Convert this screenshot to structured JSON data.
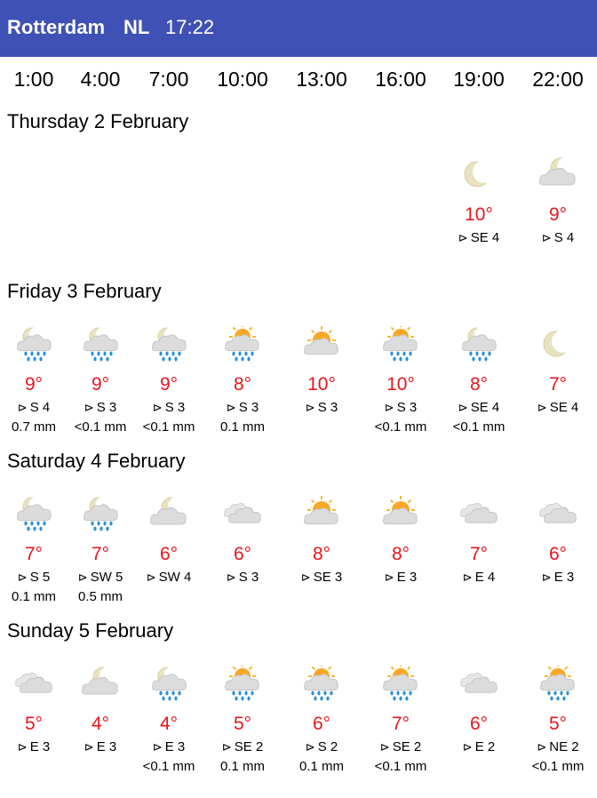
{
  "header": {
    "city": "Rotterdam",
    "country": "NL",
    "time": "17:22"
  },
  "hours": [
    "1:00",
    "4:00",
    "7:00",
    "10:00",
    "13:00",
    "16:00",
    "19:00",
    "22:00"
  ],
  "wind_arrow": "⊳",
  "colors": {
    "header_bg": "#3f51b5",
    "temperature": "#e8141b"
  },
  "days": [
    {
      "title": "Thursday 2 February",
      "slots": [
        null,
        null,
        null,
        null,
        null,
        null,
        {
          "icon": "moon-icon",
          "temp": "10°",
          "wind": "SE 4",
          "rain": ""
        },
        {
          "icon": "moon-cloud-icon",
          "temp": "9°",
          "wind": "S 4",
          "rain": ""
        }
      ]
    },
    {
      "title": "Friday 3 February",
      "slots": [
        {
          "icon": "moon-cloud-rain-icon",
          "temp": "9°",
          "wind": "S 4",
          "rain": "0.7 mm"
        },
        {
          "icon": "moon-cloud-rain-icon",
          "temp": "9°",
          "wind": "S 3",
          "rain": "<0.1 mm"
        },
        {
          "icon": "moon-cloud-rain-icon",
          "temp": "9°",
          "wind": "S 3",
          "rain": "<0.1 mm"
        },
        {
          "icon": "sun-cloud-rain-icon",
          "temp": "8°",
          "wind": "S 3",
          "rain": "0.1 mm"
        },
        {
          "icon": "sun-cloud-icon",
          "temp": "10°",
          "wind": "S 3",
          "rain": ""
        },
        {
          "icon": "sun-cloud-rain-icon",
          "temp": "10°",
          "wind": "S 3",
          "rain": "<0.1 mm"
        },
        {
          "icon": "moon-cloud-rain-icon",
          "temp": "8°",
          "wind": "SE 4",
          "rain": "<0.1 mm"
        },
        {
          "icon": "moon-icon",
          "temp": "7°",
          "wind": "SE 4",
          "rain": ""
        }
      ]
    },
    {
      "title": "Saturday 4 February",
      "slots": [
        {
          "icon": "moon-cloud-rain-icon",
          "temp": "7°",
          "wind": "S 5",
          "rain": "0.1 mm"
        },
        {
          "icon": "moon-cloud-rain-icon",
          "temp": "7°",
          "wind": "SW 5",
          "rain": "0.5 mm"
        },
        {
          "icon": "moon-cloud-icon",
          "temp": "6°",
          "wind": "SW 4",
          "rain": ""
        },
        {
          "icon": "clouds-icon",
          "temp": "6°",
          "wind": "S 3",
          "rain": ""
        },
        {
          "icon": "sun-cloud-icon",
          "temp": "8°",
          "wind": "SE 3",
          "rain": ""
        },
        {
          "icon": "sun-cloud-icon",
          "temp": "8°",
          "wind": "E 3",
          "rain": ""
        },
        {
          "icon": "clouds-icon",
          "temp": "7°",
          "wind": "E 4",
          "rain": ""
        },
        {
          "icon": "clouds-icon",
          "temp": "6°",
          "wind": "E 3",
          "rain": ""
        }
      ]
    },
    {
      "title": "Sunday 5 February",
      "slots": [
        {
          "icon": "clouds-icon",
          "temp": "5°",
          "wind": "E 3",
          "rain": ""
        },
        {
          "icon": "moon-cloud-icon",
          "temp": "4°",
          "wind": "E 3",
          "rain": ""
        },
        {
          "icon": "moon-cloud-rain-icon",
          "temp": "4°",
          "wind": "E 3",
          "rain": "<0.1 mm"
        },
        {
          "icon": "sun-cloud-rain-icon",
          "temp": "5°",
          "wind": "SE 2",
          "rain": "0.1 mm"
        },
        {
          "icon": "sun-cloud-rain-icon",
          "temp": "6°",
          "wind": "S 2",
          "rain": "0.1 mm"
        },
        {
          "icon": "sun-cloud-rain-icon",
          "temp": "7°",
          "wind": "SE 2",
          "rain": "<0.1 mm"
        },
        {
          "icon": "clouds-icon",
          "temp": "6°",
          "wind": "E 2",
          "rain": ""
        },
        {
          "icon": "sun-cloud-rain-icon",
          "temp": "5°",
          "wind": "NE 2",
          "rain": "<0.1 mm"
        }
      ]
    }
  ]
}
